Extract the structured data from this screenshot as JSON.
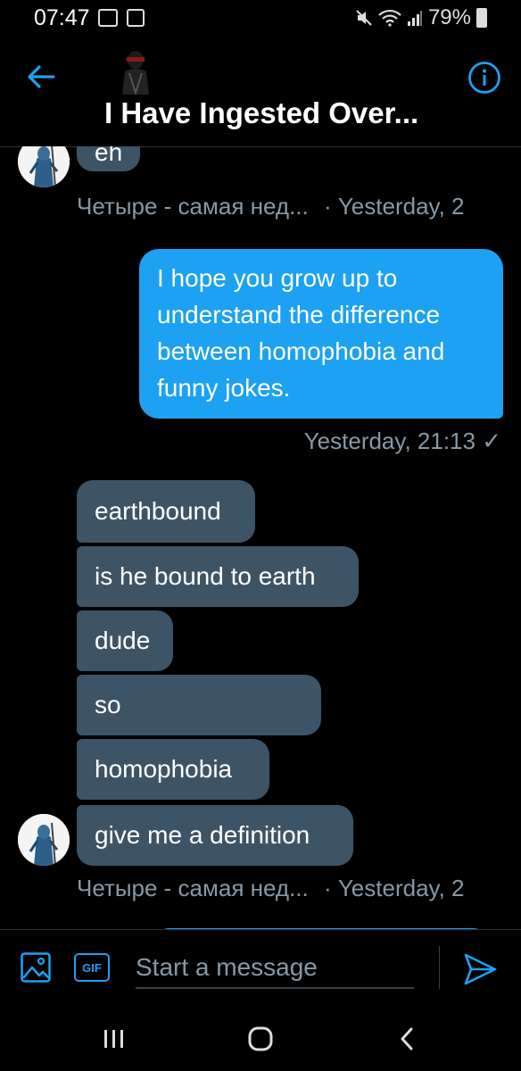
{
  "status_bar": {
    "time": "07:47",
    "battery": "79%"
  },
  "header": {
    "title": "I Have Ingested Over..."
  },
  "messages": {
    "m0": "eh",
    "meta1_sender": "Четыре - самая нед...",
    "meta1_time": "· Yesterday, 2",
    "outgoing": "I hope you grow up to understand the difference between homophobia and funny jokes.",
    "outgoing_time": "Yesterday, 21:13 ✓",
    "m1": "earthbound",
    "m2": "is he bound to earth",
    "m3": "dude",
    "m4": "so",
    "m5": "homophobia",
    "m6": "give me a definition",
    "meta2_sender": "Четыре - самая нед...",
    "meta2_time": "· Yesterday, 2"
  },
  "composer": {
    "placeholder": "Start a message",
    "gif_label": "GIF"
  },
  "colors": {
    "accent": "#1da1f2",
    "incoming_bubble": "#3d5466",
    "meta_text": "#8899a6",
    "background": "#000000"
  },
  "icons": [
    "arrow-left-icon",
    "info-icon",
    "image-icon",
    "gif-icon",
    "send-icon",
    "recents-icon",
    "home-icon",
    "back-nav-icon"
  ]
}
